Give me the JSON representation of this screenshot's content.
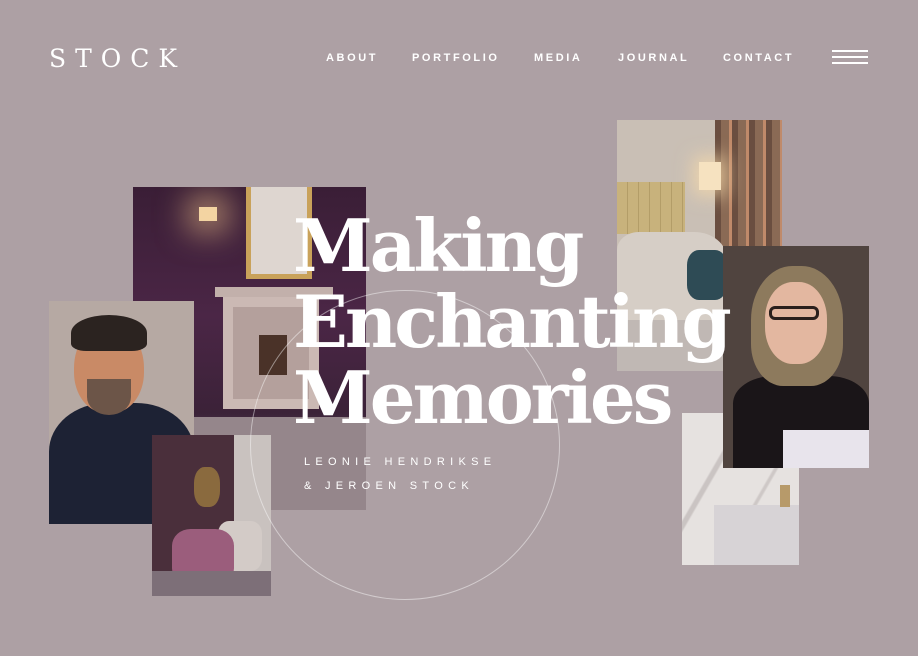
{
  "brand": {
    "logo": "STOCK"
  },
  "nav": {
    "items": [
      {
        "label": "ABOUT"
      },
      {
        "label": "PORTFOLIO"
      },
      {
        "label": "MEDIA"
      },
      {
        "label": "JOURNAL"
      },
      {
        "label": "CONTACT"
      }
    ],
    "menu_icon": "hamburger-icon"
  },
  "hero": {
    "headline": [
      "Making",
      "Enchanting",
      "Memories"
    ],
    "names": [
      "LEONIE HENDRIKSE",
      "& JEROEN STOCK"
    ]
  },
  "colors": {
    "background": "#ada0a4",
    "text": "#ffffff"
  }
}
